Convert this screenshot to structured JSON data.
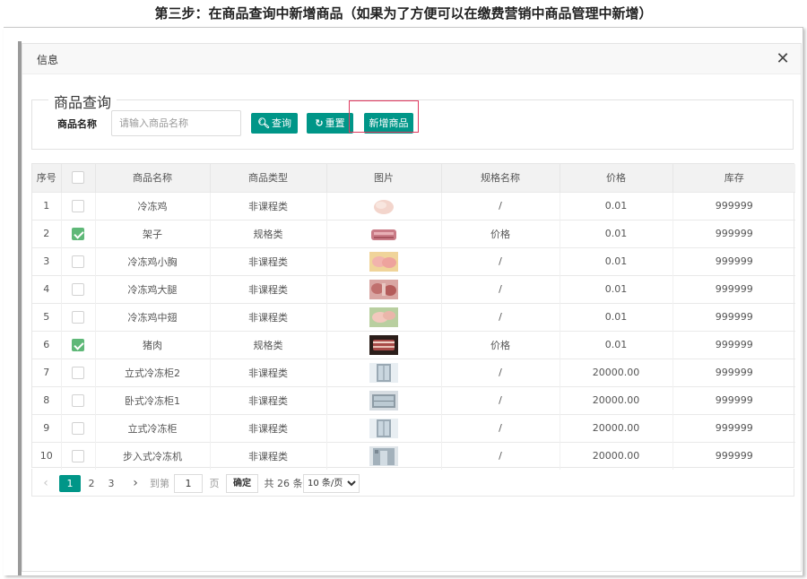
{
  "page": {
    "heading": "第三步：在商品查询中新增商品（如果为了方便可以在缴费营销中商品管理中新增）"
  },
  "dialog": {
    "title": "信息",
    "close_label": "✕"
  },
  "search": {
    "legend": "商品查询",
    "field_label": "商品名称",
    "placeholder": "请输入商品名称",
    "value": "",
    "query_label": "查询",
    "reset_label": "重置",
    "add_label": "新增商品"
  },
  "table": {
    "columns": [
      "序号",
      "",
      "商品名称",
      "商品类型",
      "图片",
      "规格名称",
      "价格",
      "库存"
    ],
    "rows": [
      {
        "index": "1",
        "checked": false,
        "name": "冷冻鸡",
        "type": "非课程类",
        "image": "frozen-chicken-photo",
        "spec": "/",
        "price": "0.01",
        "stock": "999999"
      },
      {
        "index": "2",
        "checked": true,
        "name": "架子",
        "type": "规格类",
        "image": "rack-meat-photo",
        "spec": "价格",
        "price": "0.01",
        "stock": "999999"
      },
      {
        "index": "3",
        "checked": false,
        "name": "冷冻鸡小胸",
        "type": "非课程类",
        "image": "chicken-breast-photo",
        "spec": "/",
        "price": "0.01",
        "stock": "999999"
      },
      {
        "index": "4",
        "checked": false,
        "name": "冷冻鸡大腿",
        "type": "非课程类",
        "image": "chicken-thigh-photo",
        "spec": "/",
        "price": "0.01",
        "stock": "999999"
      },
      {
        "index": "5",
        "checked": false,
        "name": "冷冻鸡中翅",
        "type": "非课程类",
        "image": "chicken-wing-photo",
        "spec": "/",
        "price": "0.01",
        "stock": "999999"
      },
      {
        "index": "6",
        "checked": true,
        "name": "猪肉",
        "type": "规格类",
        "image": "pork-photo",
        "spec": "价格",
        "price": "0.01",
        "stock": "999999"
      },
      {
        "index": "7",
        "checked": false,
        "name": "立式冷冻柜2",
        "type": "非课程类",
        "image": "upright-freezer-photo",
        "spec": "/",
        "price": "20000.00",
        "stock": "999999"
      },
      {
        "index": "8",
        "checked": false,
        "name": "卧式冷冻柜1",
        "type": "非课程类",
        "image": "chest-freezer-photo",
        "spec": "/",
        "price": "20000.00",
        "stock": "999999"
      },
      {
        "index": "9",
        "checked": false,
        "name": "立式冷冻柜",
        "type": "非课程类",
        "image": "upright-freezer-photo",
        "spec": "/",
        "price": "20000.00",
        "stock": "999999"
      },
      {
        "index": "10",
        "checked": false,
        "name": "步入式冷冻机",
        "type": "非课程类",
        "image": "walkin-freezer-photo",
        "spec": "/",
        "price": "20000.00",
        "stock": "999999"
      }
    ]
  },
  "pagination": {
    "prev": "‹",
    "pages": [
      "1",
      "2",
      "3"
    ],
    "current": "1",
    "next": "›",
    "goto_label": "到第",
    "goto_value": "1",
    "page_word": "页",
    "confirm_label": "确定",
    "total_label": "共 26 条",
    "page_size_options": [
      "10 条/页"
    ],
    "page_size": "10 条/页"
  },
  "colors": {
    "accent": "#009688",
    "checked": "#5fb878",
    "highlight": "#e0395f"
  }
}
